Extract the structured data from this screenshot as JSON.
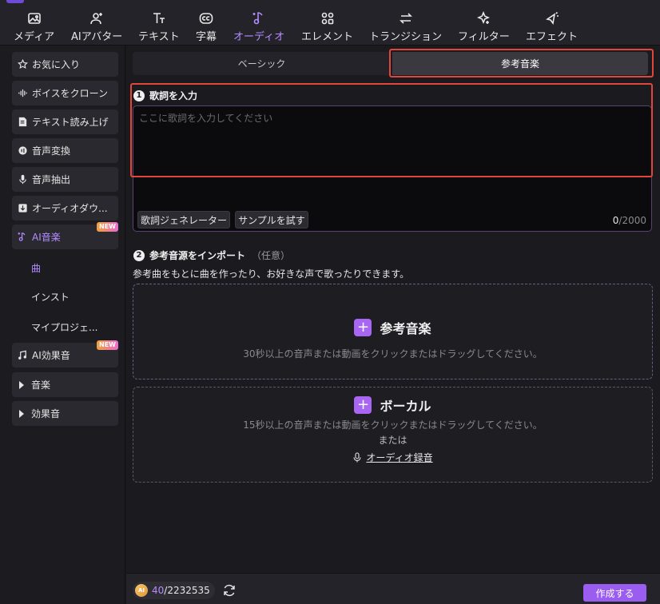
{
  "toolbar": {
    "tabs": [
      {
        "label": "メディア",
        "icon": "media-icon"
      },
      {
        "label": "AIアバター",
        "icon": "avatar-icon"
      },
      {
        "label": "テキスト",
        "icon": "text-icon"
      },
      {
        "label": "字幕",
        "icon": "caption-icon"
      },
      {
        "label": "オーディオ",
        "icon": "audio-note-icon",
        "active": true
      },
      {
        "label": "エレメント",
        "icon": "element-icon"
      },
      {
        "label": "トランジション",
        "icon": "transition-icon"
      },
      {
        "label": "フィルター",
        "icon": "filter-icon"
      },
      {
        "label": "エフェクト",
        "icon": "effect-icon"
      }
    ]
  },
  "sidebar": {
    "items": [
      {
        "label": "お気に入り",
        "icon": "star-icon"
      },
      {
        "label": "ボイスをクローン",
        "icon": "waveform-icon"
      },
      {
        "label": "テキスト読み上げ",
        "icon": "text-to-speech-icon"
      },
      {
        "label": "音声変換",
        "icon": "voice-change-icon"
      },
      {
        "label": "音声抽出",
        "icon": "microphone-icon"
      },
      {
        "label": "オーディオダウ...",
        "icon": "download-icon"
      },
      {
        "label": "AI音楽",
        "icon": "ai-music-icon",
        "badge": "NEW",
        "active": true
      },
      {
        "label": "AI効果音",
        "icon": "ai-sfx-icon",
        "badge": "NEW"
      },
      {
        "label": "音楽",
        "icon": "caret-right-icon"
      },
      {
        "label": "効果音",
        "icon": "caret-right-icon"
      }
    ],
    "sub_items": [
      {
        "label": "曲",
        "active": true
      },
      {
        "label": "インスト"
      },
      {
        "label": "マイプロジェ..."
      }
    ]
  },
  "main": {
    "segments": {
      "basic": "ベーシック",
      "reference": "参考音楽"
    },
    "step1": {
      "number": "1",
      "title": "歌詞を入力",
      "placeholder": "ここに歌詞を入力してください",
      "generator_button": "歌詞ジェネレーター",
      "sample_button": "サンプルを試す",
      "char_count": "0",
      "char_max": "/2000"
    },
    "step2": {
      "number": "2",
      "title": "参考音源をインポート",
      "optional": "（任意）",
      "description": "参考曲をもとに曲を作ったり、お好きな声で歌ったりできます。",
      "reference_zone": {
        "title": "参考音楽",
        "hint": "30秒以上の音声または動画をクリックまたはドラッグしてください。"
      },
      "vocal_zone": {
        "title": "ボーカル",
        "hint": "15秒以上の音声または動画をクリックまたはドラッグしてください。",
        "or_text": "または",
        "record_link": "オーディオ録音"
      }
    }
  },
  "bottom": {
    "coin_label": "AI",
    "credits_used": "40",
    "credits_total": "/2232535",
    "create_button": "作成する"
  },
  "colors": {
    "accent": "#b58cff",
    "button_purple": "#9b5cf0",
    "highlight_red": "#e2463a"
  }
}
